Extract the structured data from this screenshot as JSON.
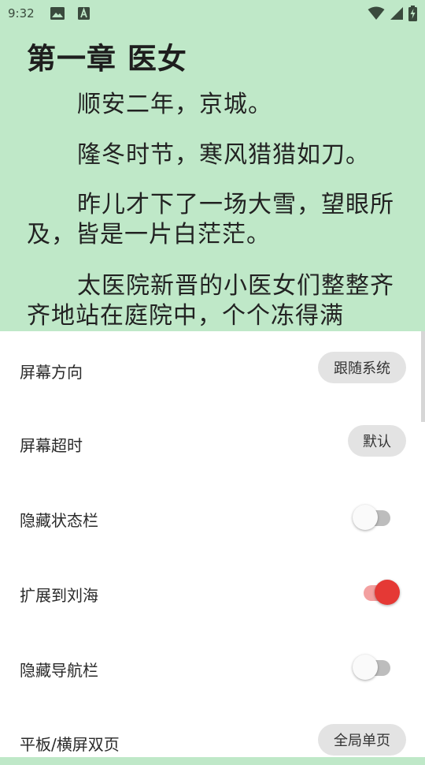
{
  "status_bar": {
    "time": "9:32",
    "icons": [
      "image-icon",
      "a-letter-icon",
      "wifi-icon",
      "signal-icon",
      "battery-charging-icon"
    ]
  },
  "reader": {
    "chapter_title": "第一章 医女",
    "paragraphs": [
      "顺安二年，京城。",
      "隆冬时节，寒风猎猎如刀。",
      "昨儿才下了一场大雪，望眼所及，皆是一片白茫茫。",
      "太医院新晋的小医女们整整齐齐地站在庭院中，个个冻得满"
    ],
    "background_color": "#bfe8c8"
  },
  "settings": {
    "screen_orientation": {
      "label": "屏幕方向",
      "value": "跟随系统"
    },
    "screen_timeout": {
      "label": "屏幕超时",
      "value": "默认"
    },
    "hide_status_bar": {
      "label": "隐藏状态栏",
      "enabled": false
    },
    "extend_to_notch": {
      "label": "扩展到刘海",
      "enabled": true
    },
    "hide_nav_bar": {
      "label": "隐藏导航栏",
      "enabled": false
    },
    "tablet_double_page": {
      "label": "平板/横屏双页",
      "value": "全局单页"
    }
  },
  "colors": {
    "accent": "#e53935",
    "accent_track": "#f3a0a0",
    "pill_bg": "#e3e3e3"
  }
}
